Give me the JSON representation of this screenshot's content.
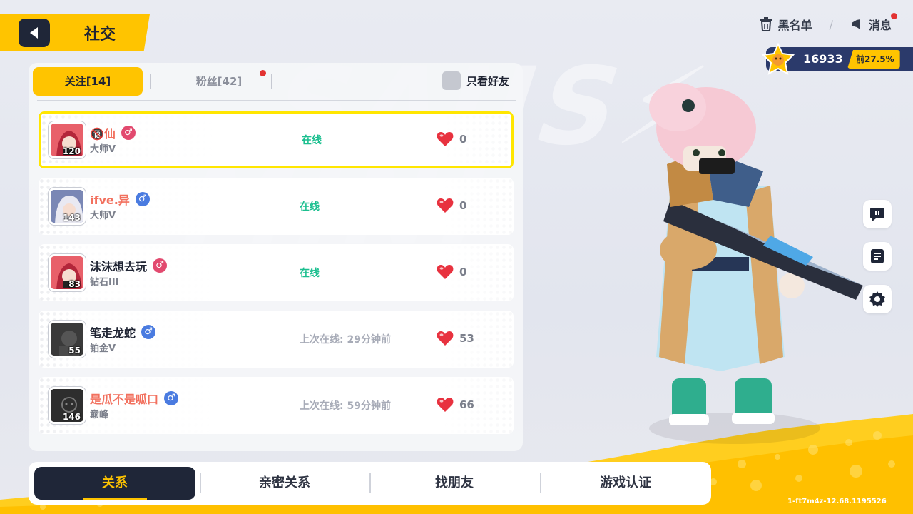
{
  "header": {
    "title": "社交",
    "blacklist_label": "黑名单",
    "separator": "/",
    "messages_label": "消息"
  },
  "score": {
    "value": "16933",
    "rank": "前27.5%"
  },
  "tabs": {
    "following": "关注[14]",
    "fans": "粉丝[42]",
    "only_friends": "只看好友"
  },
  "friends": [
    {
      "name": "🔞仙",
      "name_color": "#f2705e",
      "gender": "♂",
      "gender_color": "#e24a6f",
      "rank": "大师V",
      "status": "在线",
      "online": true,
      "likes": "0",
      "level": "120"
    },
    {
      "name": "ifve.异",
      "name_color": "#f2705e",
      "gender": "♂",
      "gender_color": "#4a7be0",
      "rank": "大师V",
      "status": "在线",
      "online": true,
      "likes": "0",
      "level": "143"
    },
    {
      "name": "沫沫想去玩",
      "name_color": "#1f2433",
      "gender": "♂",
      "gender_color": "#e24a6f",
      "rank": "钻石III",
      "status": "在线",
      "online": true,
      "likes": "0",
      "level": "83"
    },
    {
      "name": "笔走龙蛇",
      "name_color": "#1f2433",
      "gender": "♂",
      "gender_color": "#4a7be0",
      "rank": "铂金V",
      "status": "上次在线: 29分钟前",
      "online": false,
      "likes": "53",
      "level": "55"
    },
    {
      "name": "是瓜不是呱口",
      "name_color": "#f2705e",
      "gender": "♂",
      "gender_color": "#4a7be0",
      "rank": "巅峰",
      "status": "上次在线: 59分钟前",
      "online": false,
      "likes": "66",
      "level": "146"
    }
  ],
  "bottom_nav": [
    "关系",
    "亲密关系",
    "找朋友",
    "游戏认证"
  ],
  "icons": {
    "back": "back-arrow-icon",
    "blacklist": "trash-icon",
    "messages": "megaphone-icon",
    "heart": "heart-icon",
    "chat": "chat-bubble-icon",
    "notes": "notes-icon",
    "settings": "gear-icon"
  },
  "colors": {
    "accent": "#ffc400",
    "dark": "#1f2638",
    "online": "#1bbf8f"
  },
  "version": "1-ft7m4z-12.68.1195526"
}
